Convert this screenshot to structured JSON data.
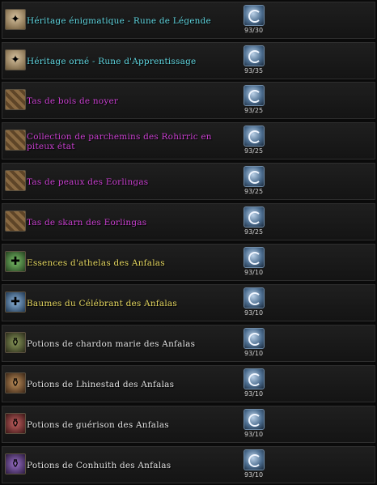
{
  "colors": {
    "cyan": "#5fd6e0",
    "magenta": "#c93fd0",
    "yellow": "#e6d860",
    "white": "#e2e2e2"
  },
  "items": [
    {
      "name": [
        "Héritage énigmatique - Rune de Légende"
      ],
      "count": "93/30",
      "color": "#5fd6e0",
      "icon": "rune-icon"
    },
    {
      "name": [
        "Héritage orné - Rune d'Apprentissage"
      ],
      "count": "93/35",
      "color": "#5fd6e0",
      "icon": "rune-icon"
    },
    {
      "name": [
        "Tas de bois de noyer"
      ],
      "count": "93/25",
      "color": "#c93fd0",
      "icon": "crate-icon"
    },
    {
      "name": [
        "Collection de parchemins des Rohirric en",
        "piteux état"
      ],
      "count": "93/25",
      "color": "#c93fd0",
      "icon": "crate-icon"
    },
    {
      "name": [
        "Tas de peaux des Eorlingas"
      ],
      "count": "93/25",
      "color": "#c93fd0",
      "icon": "crate-icon"
    },
    {
      "name": [
        "Tas de skarn des Eorlingas"
      ],
      "count": "93/25",
      "color": "#c93fd0",
      "icon": "crate-icon"
    },
    {
      "name": [
        "Essences d'athelas des Anfalas"
      ],
      "count": "93/10",
      "color": "#e6d860",
      "icon": "athelas-essence-icon"
    },
    {
      "name": [
        "Baumes du Célébrant des Anfalas"
      ],
      "count": "93/10",
      "color": "#e6d860",
      "icon": "balm-icon"
    },
    {
      "name": [
        "Potions de chardon marie des Anfalas"
      ],
      "count": "93/10",
      "color": "#e2e2e2",
      "icon": "potion-icon"
    },
    {
      "name": [
        "Potions de Lhinestad des Anfalas"
      ],
      "count": "93/10",
      "color": "#e2e2e2",
      "icon": "potion-icon"
    },
    {
      "name": [
        "Potions de guérison des Anfalas"
      ],
      "count": "93/10",
      "color": "#e2e2e2",
      "icon": "potion-icon"
    },
    {
      "name": [
        "Potions de Conhuith des Anfalas"
      ],
      "count": "93/10",
      "color": "#e2e2e2",
      "icon": "potion-icon"
    }
  ]
}
